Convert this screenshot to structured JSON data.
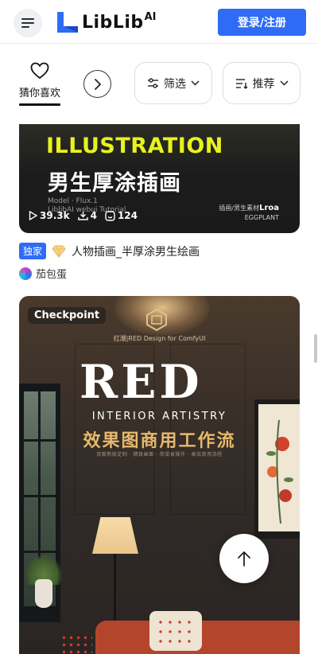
{
  "header": {
    "logo_text": "LibLib",
    "logo_sup": "AI",
    "login_label": "登录/注册"
  },
  "filters": {
    "tab_label": "猜你喜欢",
    "filter_label": "筛选",
    "sort_label": "推荐"
  },
  "card1": {
    "title_en": "ILLUSTRATION",
    "title_zh": "男生厚涂插画",
    "model_line": "Model · Flux.1",
    "workflow_line": "LiblibAI webui Tutorial",
    "stats": {
      "runs": "39.3k",
      "downloads": "4",
      "likes": "124"
    },
    "brand_top": "插画/男生素材",
    "brand_name": "Lroa",
    "brand_sub": "EGGPLANT",
    "badge": "独家",
    "name": "人物插画_半厚涂男生绘画",
    "author": "茄包蛋"
  },
  "card2": {
    "type_label": "Checkpoint",
    "sub_brand": "红潮|RED Design for ComfyUI",
    "big_title": "RED",
    "subtitle_en": "INTERIOR ARTISTRY",
    "title_zh": "效果图商用工作流",
    "tiny_line": "双套新版定制 · 精致画面 · 简单易操作 · 高效商用流程"
  },
  "icons": {
    "menu": "hamburger-menu-icon",
    "heart": "heart-icon",
    "next": "chevron-right-icon",
    "filter": "sliders-icon",
    "sort": "sort-list-icon",
    "back_to_top": "arrow-up-icon"
  },
  "colors": {
    "primary": "#2f6cf6",
    "accent_yellow": "#e8f21e",
    "gold": "#e7b96d"
  }
}
